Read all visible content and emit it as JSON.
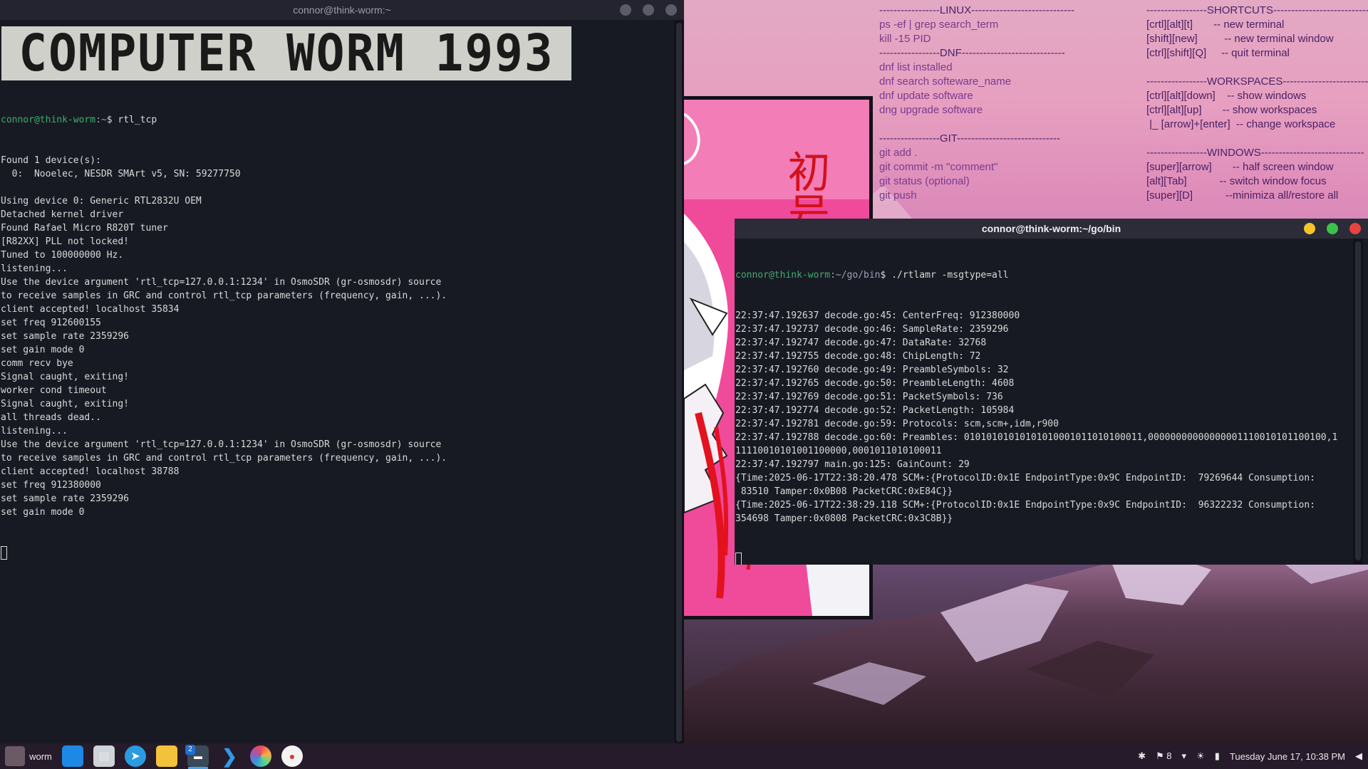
{
  "desktop": {
    "cheatsheet_left": [
      {
        "type": "head",
        "text": "-----------------LINUX-----------------------------"
      },
      {
        "type": "cmd",
        "text": "ps -ef | grep search_term"
      },
      {
        "type": "cmd",
        "text": "kill -15 PID"
      },
      {
        "type": "head",
        "text": "-----------------DNF-----------------------------"
      },
      {
        "type": "cmd",
        "text": "dnf list installed"
      },
      {
        "type": "cmd",
        "text": "dnf search softeware_name"
      },
      {
        "type": "cmd",
        "text": "dnf update software"
      },
      {
        "type": "cmd",
        "text": "dng upgrade software"
      },
      {
        "type": "blank",
        "text": ""
      },
      {
        "type": "head",
        "text": "-----------------GIT-----------------------------"
      },
      {
        "type": "cmd",
        "text": "git add ."
      },
      {
        "type": "cmd",
        "text": "git commit -m \"comment\""
      },
      {
        "type": "cmd",
        "text": "git status (optional)"
      },
      {
        "type": "cmd",
        "text": "git push"
      }
    ],
    "cheatsheet_right": [
      {
        "type": "head",
        "text": "-----------------SHORTCUTS---------------------------"
      },
      {
        "type": "key",
        "text": "[crtl][alt][t]       -- new terminal"
      },
      {
        "type": "key",
        "text": "[shift][new]         -- new terminal window"
      },
      {
        "type": "key",
        "text": "[ctrl][shift][Q]     -- quit terminal"
      },
      {
        "type": "blank",
        "text": ""
      },
      {
        "type": "head",
        "text": "-----------------WORKSPACES-------------------------"
      },
      {
        "type": "key",
        "text": "[ctrl][alt][down]    -- show windows"
      },
      {
        "type": "key",
        "text": "[ctrl][alt][up]       -- show workspaces"
      },
      {
        "type": "key",
        "text": " |_ [arrow]+[enter]  -- change workspace"
      },
      {
        "type": "blank",
        "text": ""
      },
      {
        "type": "head",
        "text": "-----------------WINDOWS-----------------------------"
      },
      {
        "type": "key",
        "text": "[super][arrow]       -- half screen window"
      },
      {
        "type": "key",
        "text": "[alt][Tab]           -- switch window focus"
      },
      {
        "type": "key",
        "text": "[super][D]           --minimiza all/restore all"
      }
    ],
    "artwork_kanji": "初号"
  },
  "terminal_left": {
    "title": "connor@think-worm:~",
    "banner": "COMPUTER WORM 1993",
    "prompt_user": "connor@think-worm",
    "prompt_path": ":~",
    "command": "$ rtl_tcp",
    "lines": [
      "Found 1 device(s):",
      "  0:  Nooelec, NESDR SMArt v5, SN: 59277750",
      "",
      "Using device 0: Generic RTL2832U OEM",
      "Detached kernel driver",
      "Found Rafael Micro R820T tuner",
      "[R82XX] PLL not locked!",
      "Tuned to 100000000 Hz.",
      "listening...",
      "Use the device argument 'rtl_tcp=127.0.0.1:1234' in OsmoSDR (gr-osmosdr) source",
      "to receive samples in GRC and control rtl_tcp parameters (frequency, gain, ...).",
      "client accepted! localhost 35834",
      "set freq 912600155",
      "set sample rate 2359296",
      "set gain mode 0",
      "comm recv bye",
      "Signal caught, exiting!",
      "worker cond timeout",
      "Signal caught, exiting!",
      "all threads dead..",
      "listening...",
      "Use the device argument 'rtl_tcp=127.0.0.1:1234' in OsmoSDR (gr-osmosdr) source",
      "to receive samples in GRC and control rtl_tcp parameters (frequency, gain, ...).",
      "client accepted! localhost 38788",
      "set freq 912380000",
      "set sample rate 2359296",
      "set gain mode 0"
    ]
  },
  "terminal_right": {
    "title": "connor@think-worm:~/go/bin",
    "prompt_user": "connor@think-worm",
    "prompt_path": ":~/go/bin",
    "command": "$ ./rtlamr -msgtype=all",
    "lines": [
      "22:37:47.192637 decode.go:45: CenterFreq: 912380000",
      "22:37:47.192737 decode.go:46: SampleRate: 2359296",
      "22:37:47.192747 decode.go:47: DataRate: 32768",
      "22:37:47.192755 decode.go:48: ChipLength: 72",
      "22:37:47.192760 decode.go:49: PreambleSymbols: 32",
      "22:37:47.192765 decode.go:50: PreambleLength: 4608",
      "22:37:47.192769 decode.go:51: PacketSymbols: 736",
      "22:37:47.192774 decode.go:52: PacketLength: 105984",
      "22:37:47.192781 decode.go:59: Protocols: scm,scm+,idm,r900",
      "22:37:47.192788 decode.go:60: Preambles: 01010101010101010001011010100011,00000000000000001110010101100100,1",
      "11110010101001100000,0001011010100011",
      "22:37:47.192797 main.go:125: GainCount: 29",
      "{Time:2025-06-17T22:38:20.478 SCM+:{ProtocolID:0x1E EndpointType:0x9C EndpointID:  79269644 Consumption:",
      " 83510 Tamper:0x0B08 PacketCRC:0xE84C}}",
      "{Time:2025-06-17T22:38:29.118 SCM+:{ProtocolID:0x1E EndpointType:0x9C EndpointID:  96322232 Consumption:",
      "354698 Tamper:0x0808 PacketCRC:0x3C8B}}"
    ]
  },
  "taskbar": {
    "menu_label": "worm",
    "workspace_badge": "2",
    "notification_count": "8",
    "clock": "Tuesday June 17, 10:38 PM"
  }
}
